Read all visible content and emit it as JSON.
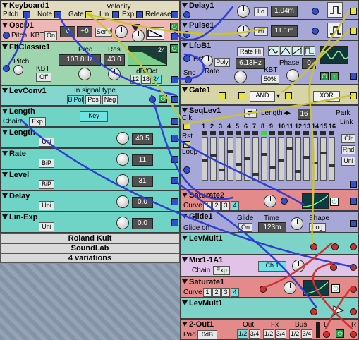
{
  "modules": {
    "keyboard": {
      "title": "Keyboard1",
      "pitch": "Pitch",
      "note": "Note",
      "velocity": "Velocity",
      "gate": "Gate",
      "lin": "Lin",
      "exp": "Exp",
      "release": "Release"
    },
    "osc": {
      "title": "OscD1",
      "pitch": "Pitch",
      "kbt": "KBT",
      "kbt_value": "On",
      "coarse": "0",
      "fine": "+0",
      "semi": "Semi"
    },
    "filter": {
      "title": "FltClassic1",
      "freq_label": "Freq",
      "freq_value": "103.8Hz",
      "res_label": "Res",
      "res_value": "43.0",
      "pitch_label": "Pitch",
      "kbt_label": "KBT",
      "kbt_value": "Off",
      "slope_label": "dB/Oct",
      "slopes": [
        "12",
        "18",
        "24"
      ],
      "graph_value": "24"
    },
    "levconv": {
      "title": "LevConv1",
      "signal_label": "In signal type",
      "options": [
        "BiPol",
        "Pos",
        "Neg"
      ]
    },
    "length": {
      "title": "Length",
      "chain": "Chain",
      "exp": "Exp",
      "key": "Key"
    },
    "length2": {
      "title": "Length",
      "mode": "Uni",
      "value": "40.5"
    },
    "rate": {
      "title": "Rate",
      "mode": "BiP",
      "value": "11"
    },
    "level": {
      "title": "Level",
      "mode": "BiP",
      "value": "31"
    },
    "delay": {
      "title": "Delay",
      "mode": "Uni",
      "value": "0.0"
    },
    "linexp": {
      "title": "Lin-Exp",
      "mode": "Uni",
      "value": "0.0"
    },
    "delay1": {
      "title": "Delay1",
      "mode": "Lo",
      "value": "1.04m"
    },
    "pulse1": {
      "title": "Pulse1",
      "mode": "Hi",
      "value": "11.1m"
    },
    "lfo": {
      "title": "LfoB1",
      "rst": "Rst",
      "snc": "Snc",
      "rate": "Rate",
      "rate_mode": "Rate Hi",
      "rate_value": "6.13Hz",
      "poly": "Poly",
      "kbt": "KBT",
      "kbt_value": "50%",
      "phase": "Phase",
      "phase_value": "0"
    },
    "gate": {
      "title": "Gate1",
      "op1": "AND",
      "op2": "XOR"
    },
    "seqlev": {
      "title": "SeqLev1",
      "length_label": "Length",
      "length_value": "16",
      "park": "Park",
      "link": "Link",
      "clk": "Clk",
      "rst": "Rst",
      "loop": "Loop",
      "clr": "Clr",
      "rnd": "Rnd",
      "uni": "Uni",
      "steps": [
        "1",
        "2",
        "3",
        "4",
        "5",
        "6",
        "7",
        "8",
        "9",
        "10",
        "11",
        "12",
        "13",
        "14",
        "15",
        "16"
      ]
    },
    "saturate2": {
      "title": "Saturate2",
      "curve": "Curve",
      "curves": [
        "1",
        "2",
        "3",
        "4"
      ]
    },
    "glide": {
      "title": "Glide1",
      "glide_label": "Glide",
      "glide_on": "Glide on",
      "glide_value": "On",
      "time_label": "Time",
      "time_value": "123m",
      "shape_label": "Shape",
      "shape_value": "Log"
    },
    "levmult1": {
      "title": "LevMult1"
    },
    "mix": {
      "title": "Mix1-1A1",
      "chain": "Chain",
      "exp": "Exp",
      "channel": "Ch 1"
    },
    "saturate1": {
      "title": "Saturate1",
      "curve": "Curve",
      "curves": [
        "1",
        "2",
        "3",
        "4"
      ]
    },
    "levmult2": {
      "title": "LevMult1"
    },
    "out": {
      "title": "2-Out1",
      "pad": "Pad",
      "pad_value": "0dB",
      "out_label": "Out",
      "fx_label": "Fx",
      "bus_label": "Bus",
      "ch_a": "1/2",
      "ch_b": "3/4",
      "l": "L",
      "r": "R"
    }
  },
  "footer": {
    "line1": "Roland Kuit",
    "line2": "SoundLab",
    "line3": "4 variations"
  },
  "colors": {
    "keyboard": "#e1dcc0",
    "osc": "#efb6b6",
    "filter": "#9fd5ae",
    "cyan_module": "#86d6d0",
    "teal_row": "#6fd3c5",
    "lavender": "#a8a8d8",
    "khaki": "#d7d4a7",
    "red_module": "#e48a8a",
    "pink": "#e0c3e6",
    "light_teal": "#7ed3c9"
  }
}
